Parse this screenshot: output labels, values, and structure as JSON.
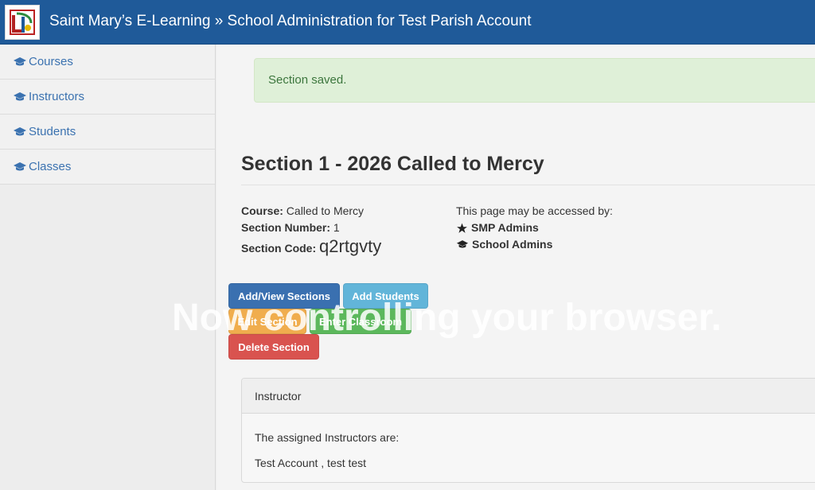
{
  "header": {
    "title": "Saint Mary’s E-Learning » School Administration for Test Parish Account",
    "logo": "saint-marys-logo"
  },
  "sidebar": {
    "items": [
      {
        "label": "Courses",
        "icon": "graduation-cap-icon"
      },
      {
        "label": "Instructors",
        "icon": "graduation-cap-icon"
      },
      {
        "label": "Students",
        "icon": "graduation-cap-icon"
      },
      {
        "label": "Classes",
        "icon": "graduation-cap-icon"
      }
    ]
  },
  "alert": {
    "text": "Section saved."
  },
  "section": {
    "title": "Section 1 - 2026 Called to Mercy",
    "course_label": "Course:",
    "course_value": "Called to Mercy",
    "number_label": "Section Number:",
    "number_value": "1",
    "code_label": "Section Code:",
    "code_value": "q2rtgvty"
  },
  "access": {
    "heading": "This page may be accessed by:",
    "roles": [
      {
        "label": "SMP Admins",
        "icon": "star-icon"
      },
      {
        "label": "School Admins",
        "icon": "graduation-cap-icon"
      }
    ]
  },
  "buttons": {
    "add_view_sections": "Add/View Sections",
    "add_students": "Add Students",
    "edit_section": "Edit Section",
    "enter_classroom": "Enter Classroom",
    "delete_section": "Delete Section"
  },
  "overlay": {
    "text": "Now controlling your browser."
  },
  "instructor_panel": {
    "heading": "Instructor",
    "intro": "The assigned Instructors are:",
    "names": "Test Account , test test"
  },
  "colors": {
    "header": "#1f5a99",
    "link": "#3b72b0",
    "primary": "#3a70b0",
    "info": "#62b5d9",
    "warning": "#f0ad4e",
    "success": "#5cb85c",
    "danger": "#d9534f",
    "alert_bg": "#dff0d8"
  }
}
